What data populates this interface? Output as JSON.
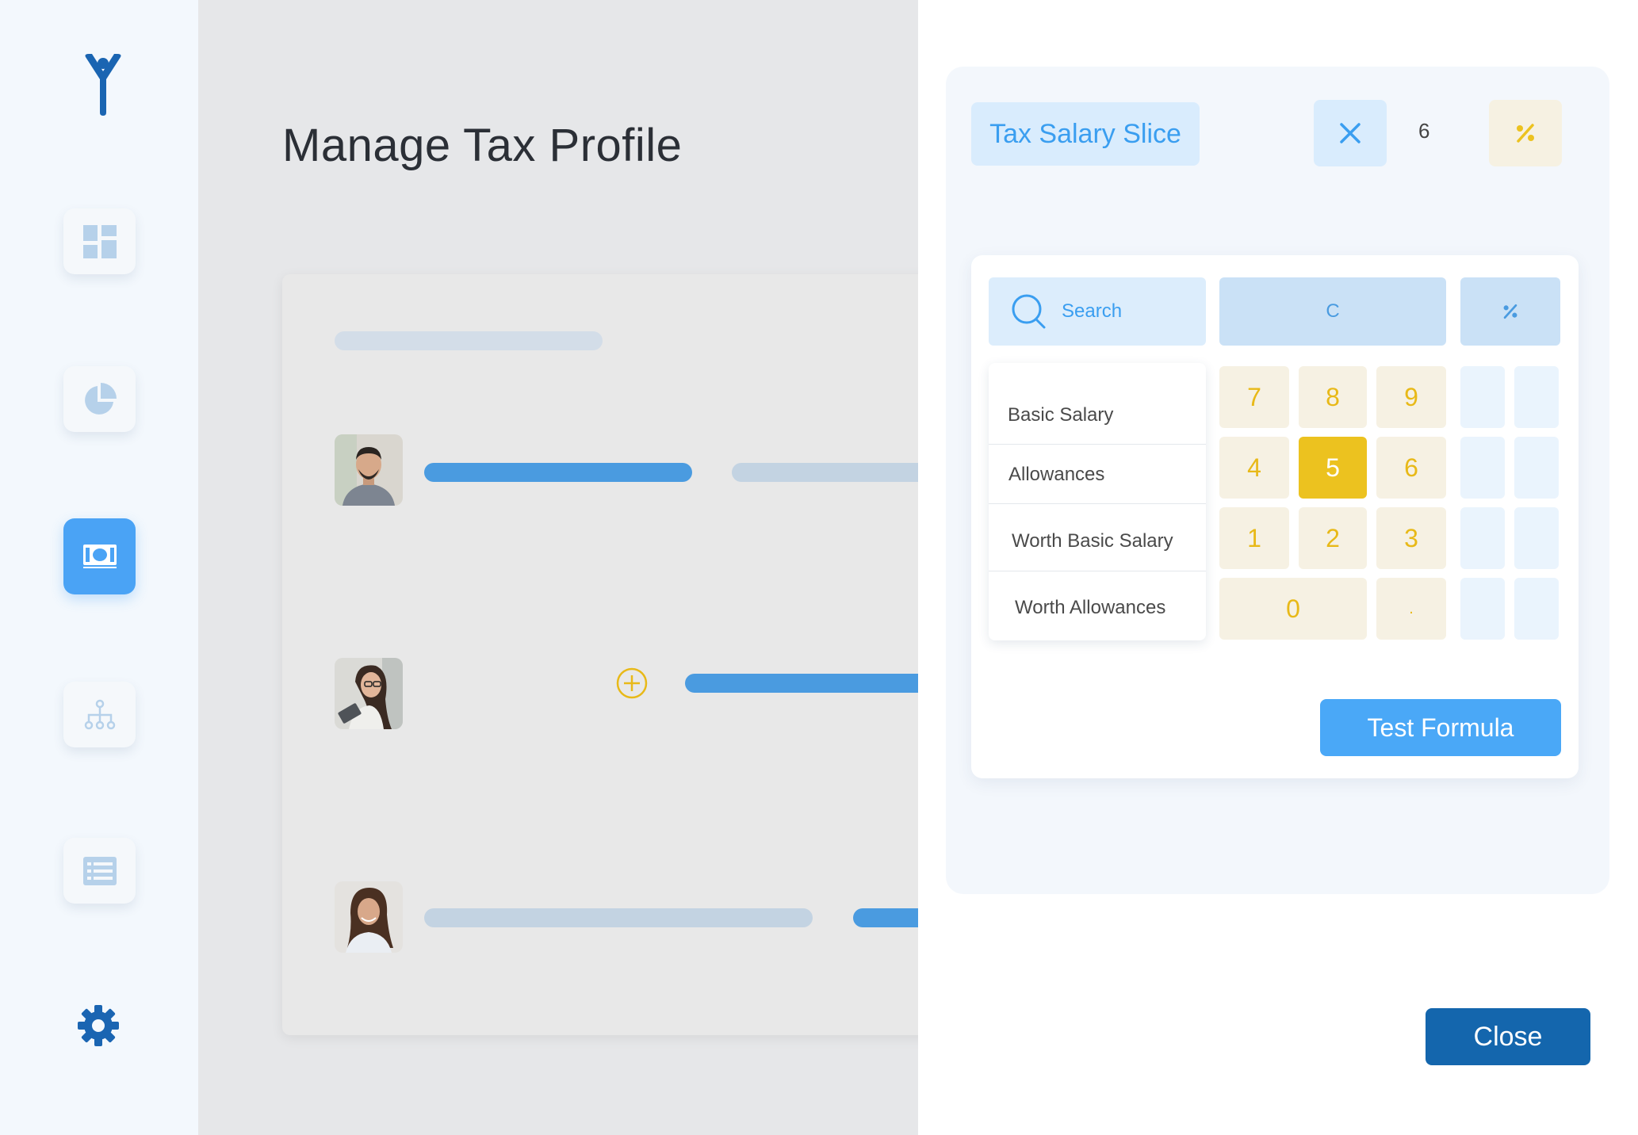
{
  "icons": {
    "logo": "y-logo-icon",
    "nav": [
      "dashboard-icon",
      "pie-chart-icon",
      "money-icon",
      "org-chart-icon",
      "list-icon"
    ],
    "settings": "gear-icon"
  },
  "colors": {
    "primary": "#4aa3f5",
    "dark_primary": "#1466ad",
    "accent_yellow": "#ecc21f"
  },
  "main": {
    "title": "Manage Tax Profile"
  },
  "editor": {
    "formula_tokens": {
      "variable": "Tax Salary Slice",
      "number": "6"
    },
    "search_placeholder": "Search",
    "clear_label": "C",
    "variables": [
      "Basic Salary",
      "Allowances",
      "Worth Basic Salary",
      "Worth Allowances"
    ],
    "keypad": {
      "rows": [
        [
          "7",
          "8",
          "9"
        ],
        [
          "4",
          "5",
          "6"
        ],
        [
          "1",
          "2",
          "3"
        ]
      ],
      "zero": "0",
      "dot": ".",
      "selected": "5"
    },
    "test_label": "Test Formula",
    "close_label": "Close"
  }
}
